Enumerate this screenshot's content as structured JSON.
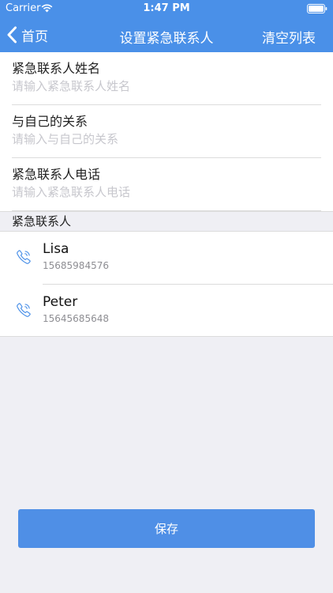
{
  "status_bar": {
    "carrier": "Carrier",
    "time": "1:47 PM",
    "wifi_icon": "wifi-icon",
    "battery_icon": "battery-icon"
  },
  "nav": {
    "back_label": "首页",
    "back_icon": "chevron-left-icon",
    "title": "设置紧急联系人",
    "right_action": "清空列表"
  },
  "form": {
    "fields": [
      {
        "label": "紧急联系人姓名",
        "placeholder": "请输入紧急联系人姓名",
        "value": ""
      },
      {
        "label": "与自己的关系",
        "placeholder": "请输入与自己的关系",
        "value": ""
      },
      {
        "label": "紧急联系人电话",
        "placeholder": "请输入紧急联系人电话",
        "value": ""
      }
    ]
  },
  "contacts_section": {
    "header": "紧急联系人",
    "items": [
      {
        "name": "Lisa",
        "phone": "15685984576",
        "icon": "phone-icon"
      },
      {
        "name": "Peter",
        "phone": "15645685648",
        "icon": "phone-icon"
      }
    ]
  },
  "save_button_label": "保存",
  "colors": {
    "accent": "#4a90e8",
    "button": "#4f8fe6",
    "background": "#efeff4",
    "placeholder": "#c7c7cd"
  }
}
